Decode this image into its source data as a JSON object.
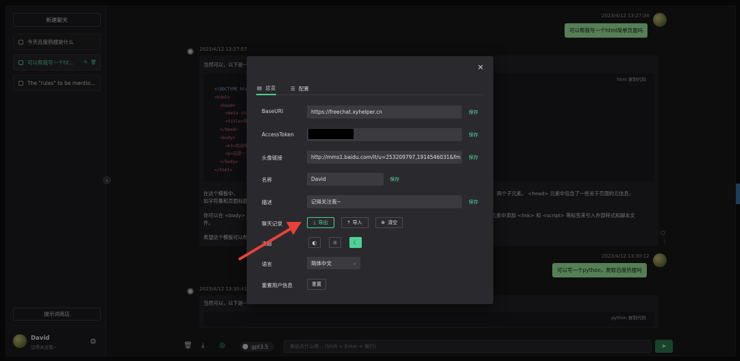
{
  "sidebar": {
    "new_chat_label": "新建聊天",
    "conversations": [
      {
        "title": "今天百度热搜是什么"
      },
      {
        "title": "可以帮我写一个ht..."
      },
      {
        "title": "The \"rules\" to be mentio..."
      }
    ],
    "prompt_store_label": "提示词商店",
    "user": {
      "name": "David",
      "description": "记得关注我~"
    }
  },
  "chat": {
    "messages": [
      {
        "time": "2023/4/12 13:27:34",
        "text": "可以帮我写一个html简单页面吗"
      },
      {
        "time": "2023/4/12 13:27:57",
        "intro": "当然可以，以下是一",
        "code_lang": "html",
        "copy_label": "复制代码",
        "code_lines": [
          "<!DOCTYPE html",
          "<html>",
          "  <head>",
          "    <meta chars",
          "    <title>我的",
          "  </head>",
          "  <body>",
          "    <h1>欢迎来",
          "    <p>这是一个",
          "  </body>",
          "</html>"
        ],
        "para1": "在这个模板中，",
        "para1_right": "两个子元素。 <head> 元素中包含了一些关于页面的元信息，",
        "para1b": "如字符集和页面标题",
        "para2": "你可以在 <body> 元",
        "para2_right": "元素中添加 <link> 和 <script> 等标签来引入外部样式和脚本文",
        "para2b": "件。",
        "para3": "希望这个模板可以帮"
      },
      {
        "time": "2023/4/12 13:30:12",
        "text": "可以写一个python，爬取百度热搜吗"
      },
      {
        "time": "2023/4/12 13:30:41",
        "intro": "当然可以，以下是一",
        "code_lang": "python",
        "copy_label": "复制代码"
      }
    ],
    "composer": {
      "model": "gpt3.5",
      "placeholder": "来说点什么吧... (Shift + Enter = 换行)"
    }
  },
  "modal": {
    "tabs": [
      {
        "label": "总览"
      },
      {
        "label": "配置"
      }
    ],
    "fields": {
      "base_uri": {
        "label": "BaseURI",
        "value": "https://freechat.xyhelper.cn",
        "save": "保存"
      },
      "access_token": {
        "label": "AccessToken",
        "value": "",
        "save": "保存"
      },
      "avatar_link": {
        "label": "头像链接",
        "value": "http://mms1.baidu.com/it/u=253209797,1914546031&fm",
        "save": "保存"
      },
      "name": {
        "label": "名称",
        "value": "David",
        "save": "保存"
      },
      "description": {
        "label": "描述",
        "value": "记得关注我~",
        "save": "保存"
      }
    },
    "chat_history": {
      "label": "聊天记录",
      "export": "导出",
      "import": "导入",
      "clear": "清空"
    },
    "theme": {
      "label": "主题"
    },
    "language": {
      "label": "语言",
      "value": "简体中文"
    },
    "reset": {
      "label": "重置用户信息",
      "button": "重置"
    }
  },
  "colors": {
    "accent": "#4fd197",
    "annotation_arrow": "#e8413a",
    "user_bubble": "#9be89b"
  }
}
